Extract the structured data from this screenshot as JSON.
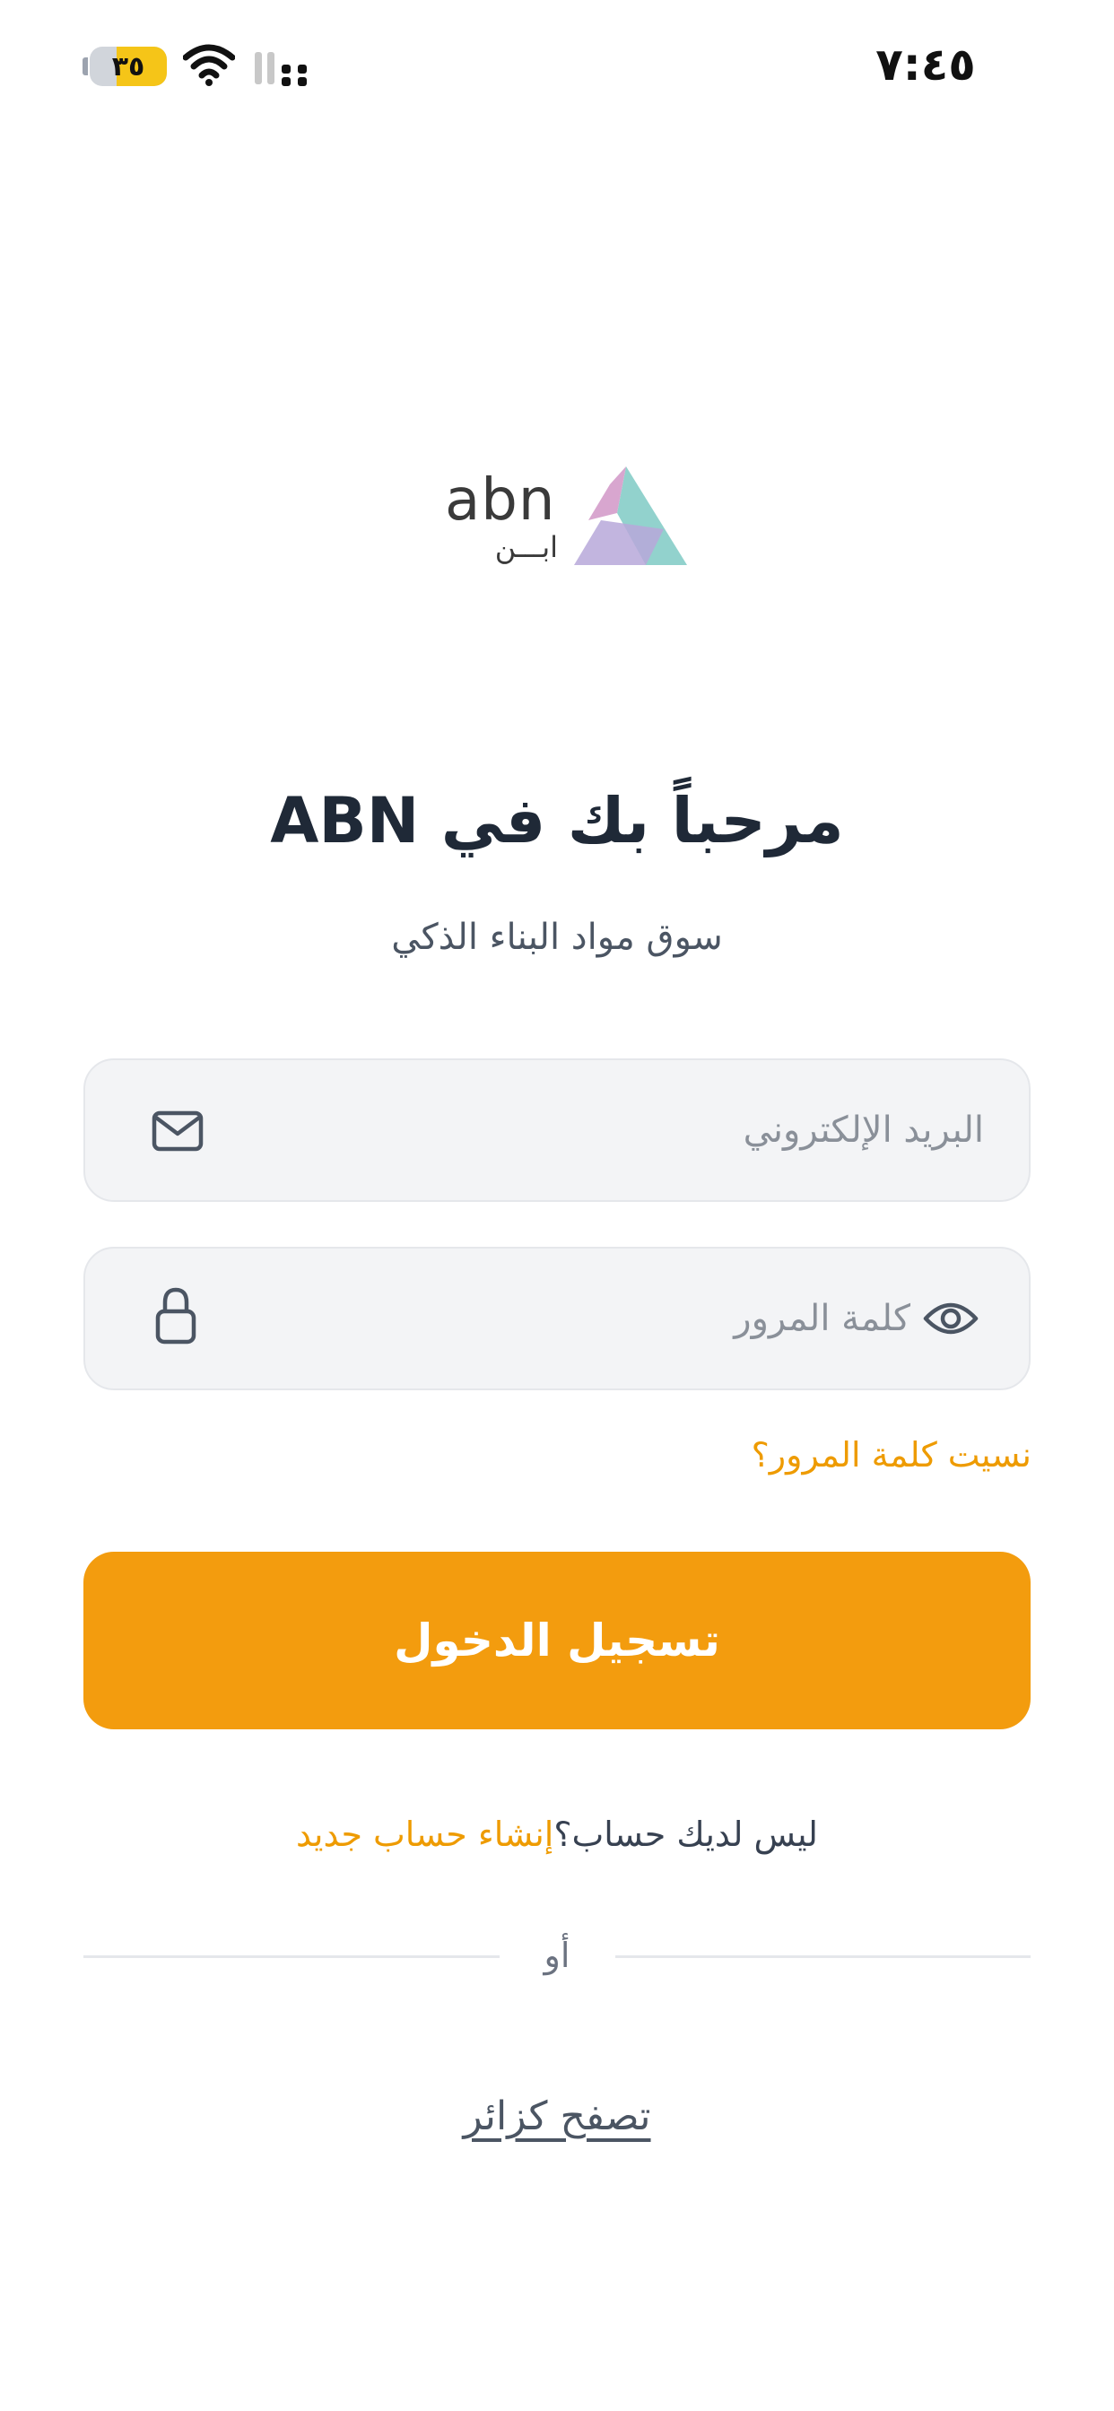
{
  "status_bar": {
    "time": "٧:٤٥",
    "battery_level": "٣٥",
    "battery_percent": 35
  },
  "logo": {
    "latin": "abn",
    "arabic": "ابـــن"
  },
  "welcome": {
    "title": "مرحباً بك في ABN",
    "subtitle": "سوق مواد البناء الذكي"
  },
  "form": {
    "email_placeholder": "البريد الإلكتروني",
    "password_placeholder": "كلمة المرور",
    "forgot_password": "نسيت كلمة المرور؟",
    "login_button": "تسجيل الدخول"
  },
  "signup": {
    "prompt": "ليس لديك حساب؟",
    "link": "إنشاء حساب جديد"
  },
  "divider": {
    "text": "أو"
  },
  "guest": {
    "label": "تصفح كزائر"
  },
  "colors": {
    "accent": "#f39c0e",
    "link": "#ee9b00",
    "field_bg": "#f3f4f6",
    "logo_pink": "#d8a6cf",
    "logo_teal": "#86cdc8",
    "logo_lilac": "#b7a8d9"
  },
  "icons": {
    "email": "envelope-icon",
    "password": "lock-icon",
    "toggle_visibility": "eye-icon",
    "wifi": "wifi-icon",
    "signal": "cellular-signal-icon"
  }
}
